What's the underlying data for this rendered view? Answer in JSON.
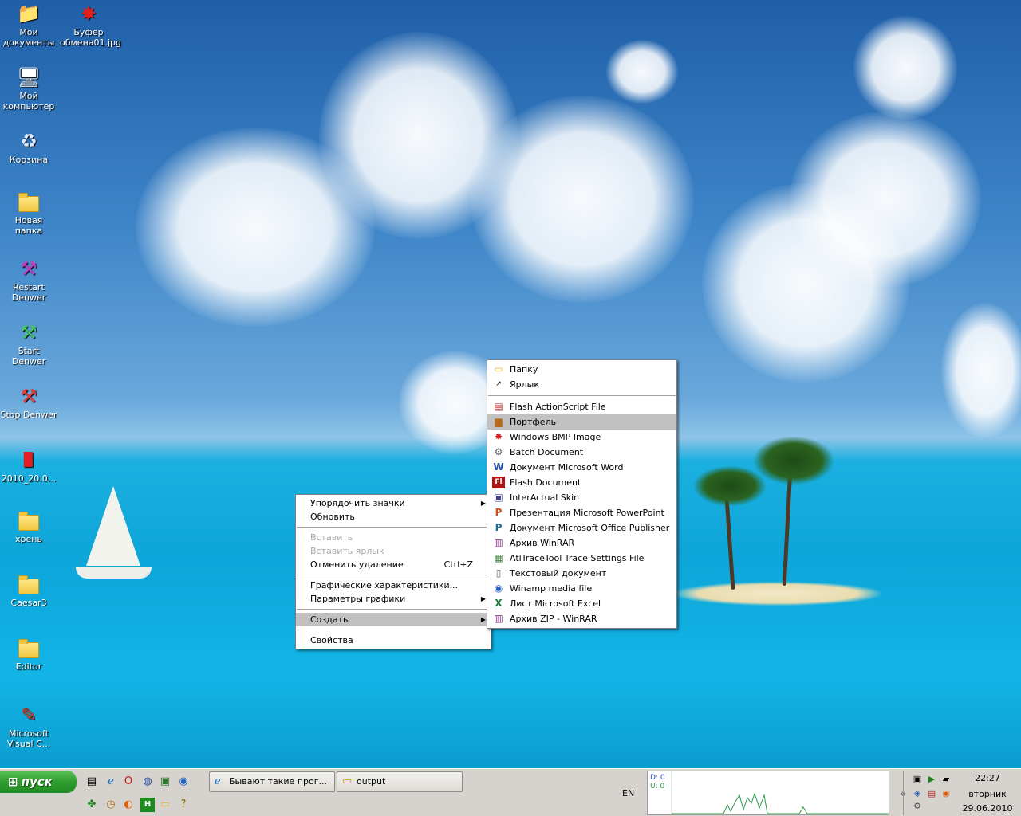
{
  "desktop_icons": [
    {
      "label": "Мои документы",
      "icon": "my-documents-icon"
    },
    {
      "label": "Буфер обмена01.jpg",
      "icon": "image-file-icon"
    },
    {
      "label": "Мой компьютер",
      "icon": "my-computer-icon"
    },
    {
      "label": "Корзина",
      "icon": "recycle-bin-icon"
    },
    {
      "label": "Новая папка",
      "icon": "folder-icon"
    },
    {
      "label": "Restart Denwer",
      "icon": "denwer-restart-icon"
    },
    {
      "label": "Start Denwer",
      "icon": "denwer-start-icon"
    },
    {
      "label": "Stop Denwer",
      "icon": "denwer-stop-icon"
    },
    {
      "label": "2010_20.0...",
      "icon": "pdf-file-icon"
    },
    {
      "label": "хрень",
      "icon": "folder-icon"
    },
    {
      "label": "Caesar3",
      "icon": "folder-icon"
    },
    {
      "label": "Editor",
      "icon": "folder-icon"
    },
    {
      "label": "Microsoft Visual C...",
      "icon": "visual-studio-icon"
    }
  ],
  "context_menu": {
    "arrange_icons": "Упорядочить значки",
    "refresh": "Обновить",
    "paste": "Вставить",
    "paste_shortcut": "Вставить ярлык",
    "undo_delete": "Отменить удаление",
    "undo_shortcut": "Ctrl+Z",
    "graphics_properties": "Графические характеристики...",
    "graphics_options": "Параметры графики",
    "create": "Создать",
    "properties": "Свойства"
  },
  "submenu": {
    "top_items": [
      {
        "label": "Папку",
        "icon": "folder-icon"
      },
      {
        "label": "Ярлык",
        "icon": "shortcut-icon"
      }
    ],
    "items": [
      {
        "label": "Flash ActionScript File",
        "icon": "actionscript-file-icon"
      },
      {
        "label": "Портфель",
        "icon": "briefcase-icon",
        "selected": true
      },
      {
        "label": "Windows BMP Image",
        "icon": "bmp-image-icon"
      },
      {
        "label": "Batch Document",
        "icon": "batch-file-icon"
      },
      {
        "label": "Документ Microsoft Word",
        "icon": "word-document-icon"
      },
      {
        "label": "Flash Document",
        "icon": "flash-document-icon"
      },
      {
        "label": "InterActual Skin",
        "icon": "skin-file-icon"
      },
      {
        "label": "Презентация Microsoft PowerPoint",
        "icon": "powerpoint-icon"
      },
      {
        "label": "Документ Microsoft Office Publisher",
        "icon": "publisher-icon"
      },
      {
        "label": "Архив WinRAR",
        "icon": "winrar-archive-icon"
      },
      {
        "label": "AtlTraceTool Trace Settings File",
        "icon": "trace-settings-icon"
      },
      {
        "label": "Текстовый документ",
        "icon": "text-document-icon"
      },
      {
        "label": "Winamp media file",
        "icon": "winamp-icon"
      },
      {
        "label": "Лист Microsoft Excel",
        "icon": "excel-icon"
      },
      {
        "label": "Архив ZIP - WinRAR",
        "icon": "zip-archive-icon"
      }
    ]
  },
  "taskbar": {
    "start_label": "пуск",
    "windows": [
      {
        "label": "Бывают такие прог...",
        "icon": "internet-explorer-icon"
      },
      {
        "label": "output",
        "icon": "folder-icon"
      }
    ],
    "language": "EN",
    "net_down": "D: 0",
    "net_up": "U: 0",
    "time": "22:27",
    "weekday": "вторник",
    "date": "29.06.2010"
  }
}
